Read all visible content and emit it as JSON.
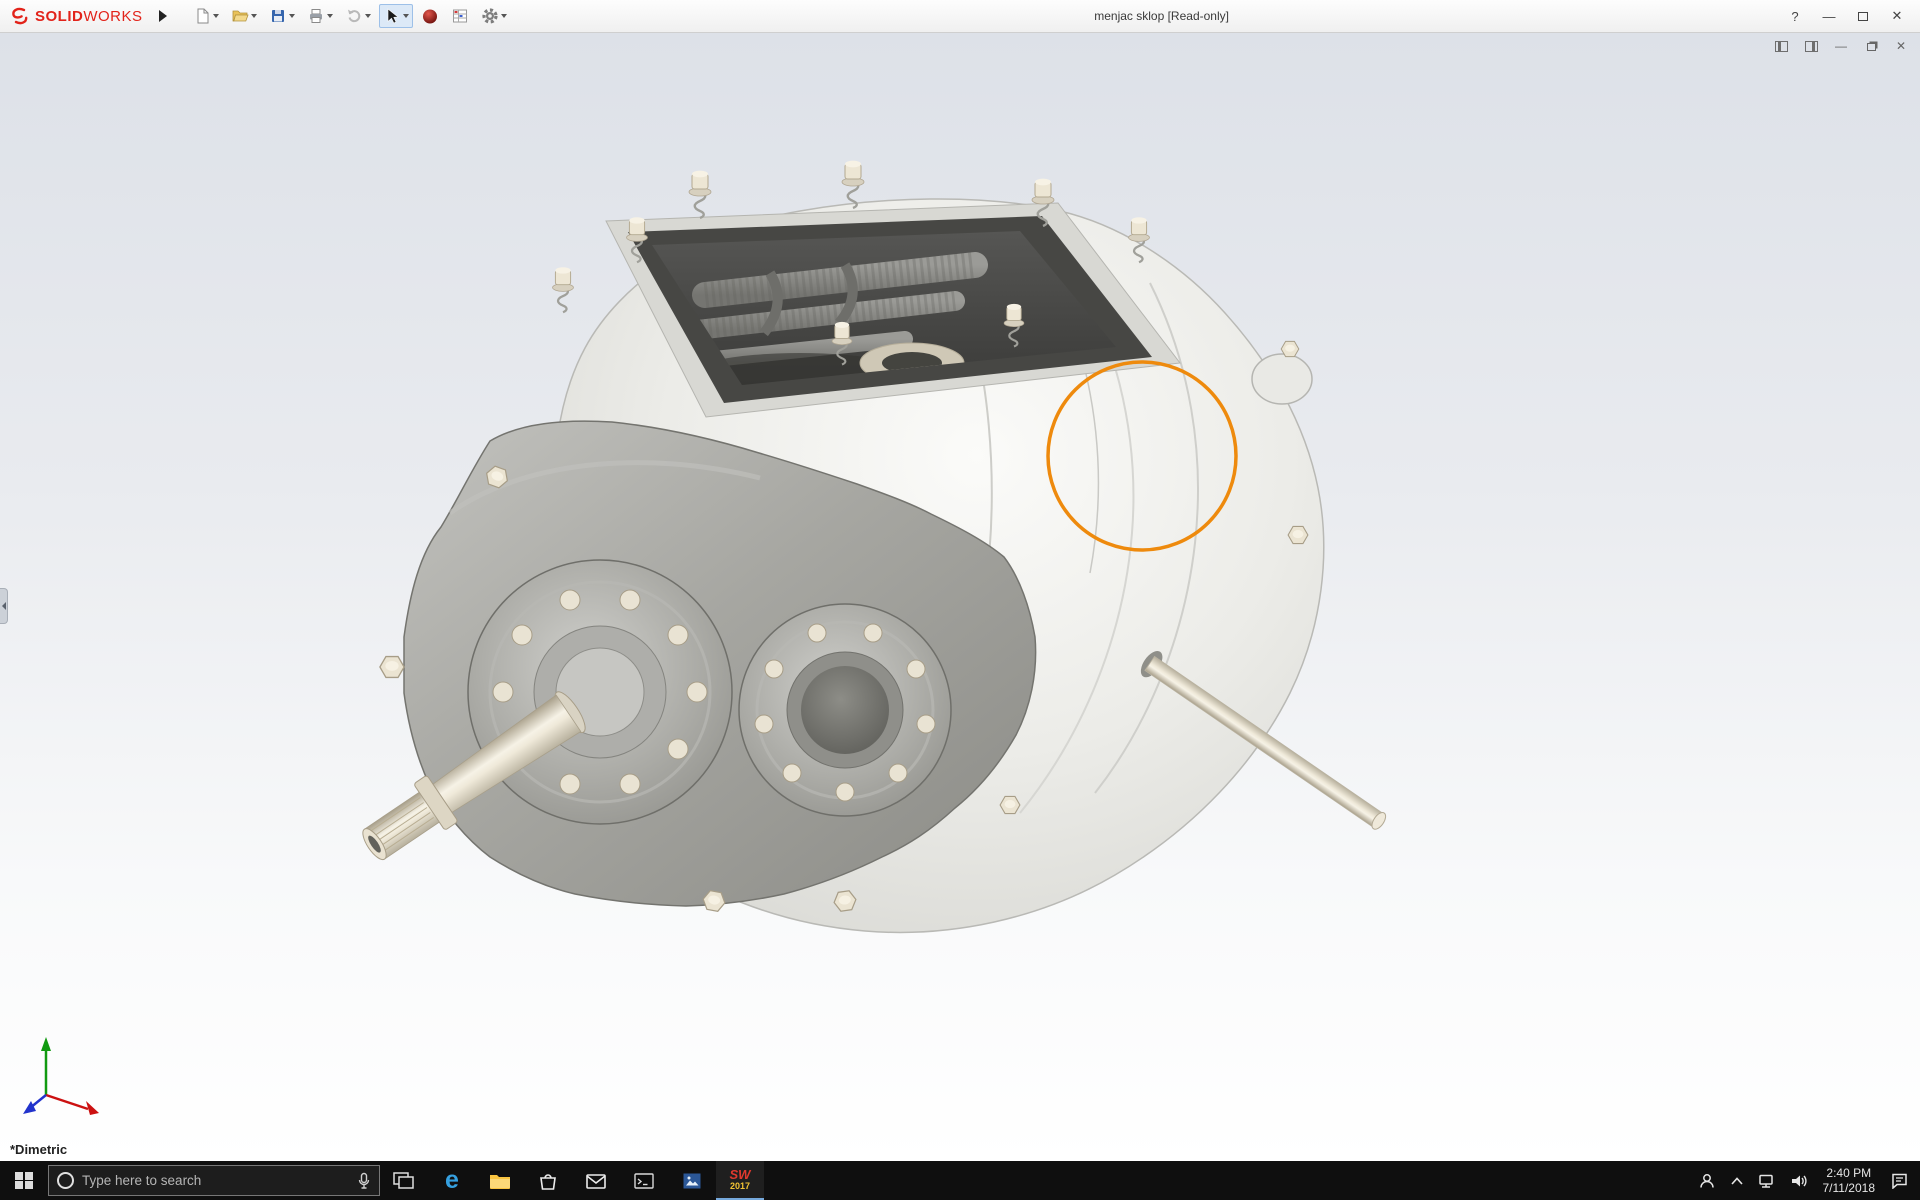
{
  "titlebar": {
    "brand_solid": "SOLID",
    "brand_works": "WORKS",
    "document_title": "menjac sklop [Read-only]",
    "window_buttons": {
      "help": "?",
      "minimize": "—",
      "close": "✕"
    },
    "toolbar_icons": [
      "flyout-arrow",
      "new-document",
      "open-document",
      "save",
      "print",
      "undo",
      "select-tool",
      "appearance-sphere",
      "spreadsheet",
      "options-gear"
    ]
  },
  "viewport": {
    "view_orientation_label": "*Dimetric",
    "annotation_color": "#ee8a0d",
    "controls": {
      "minimize": "—",
      "close": "✕"
    },
    "triad": {
      "x_color": "#cc1111",
      "y_color": "#119a11",
      "z_color": "#2233cc"
    }
  },
  "taskbar": {
    "search_placeholder": "Type here to search",
    "edge_glyph": "e",
    "app_icons": [
      "start",
      "cortana",
      "task-view",
      "edge",
      "file-explorer",
      "store",
      "mail",
      "console",
      "photos",
      "solidworks"
    ],
    "solidworks_badge_letters": "SW",
    "solidworks_badge_year": "2017",
    "tray_icons": [
      "people",
      "tray-expand",
      "network",
      "volume",
      "action-center"
    ],
    "clock_time": "2:40 PM",
    "clock_date": "7/11/2018"
  }
}
